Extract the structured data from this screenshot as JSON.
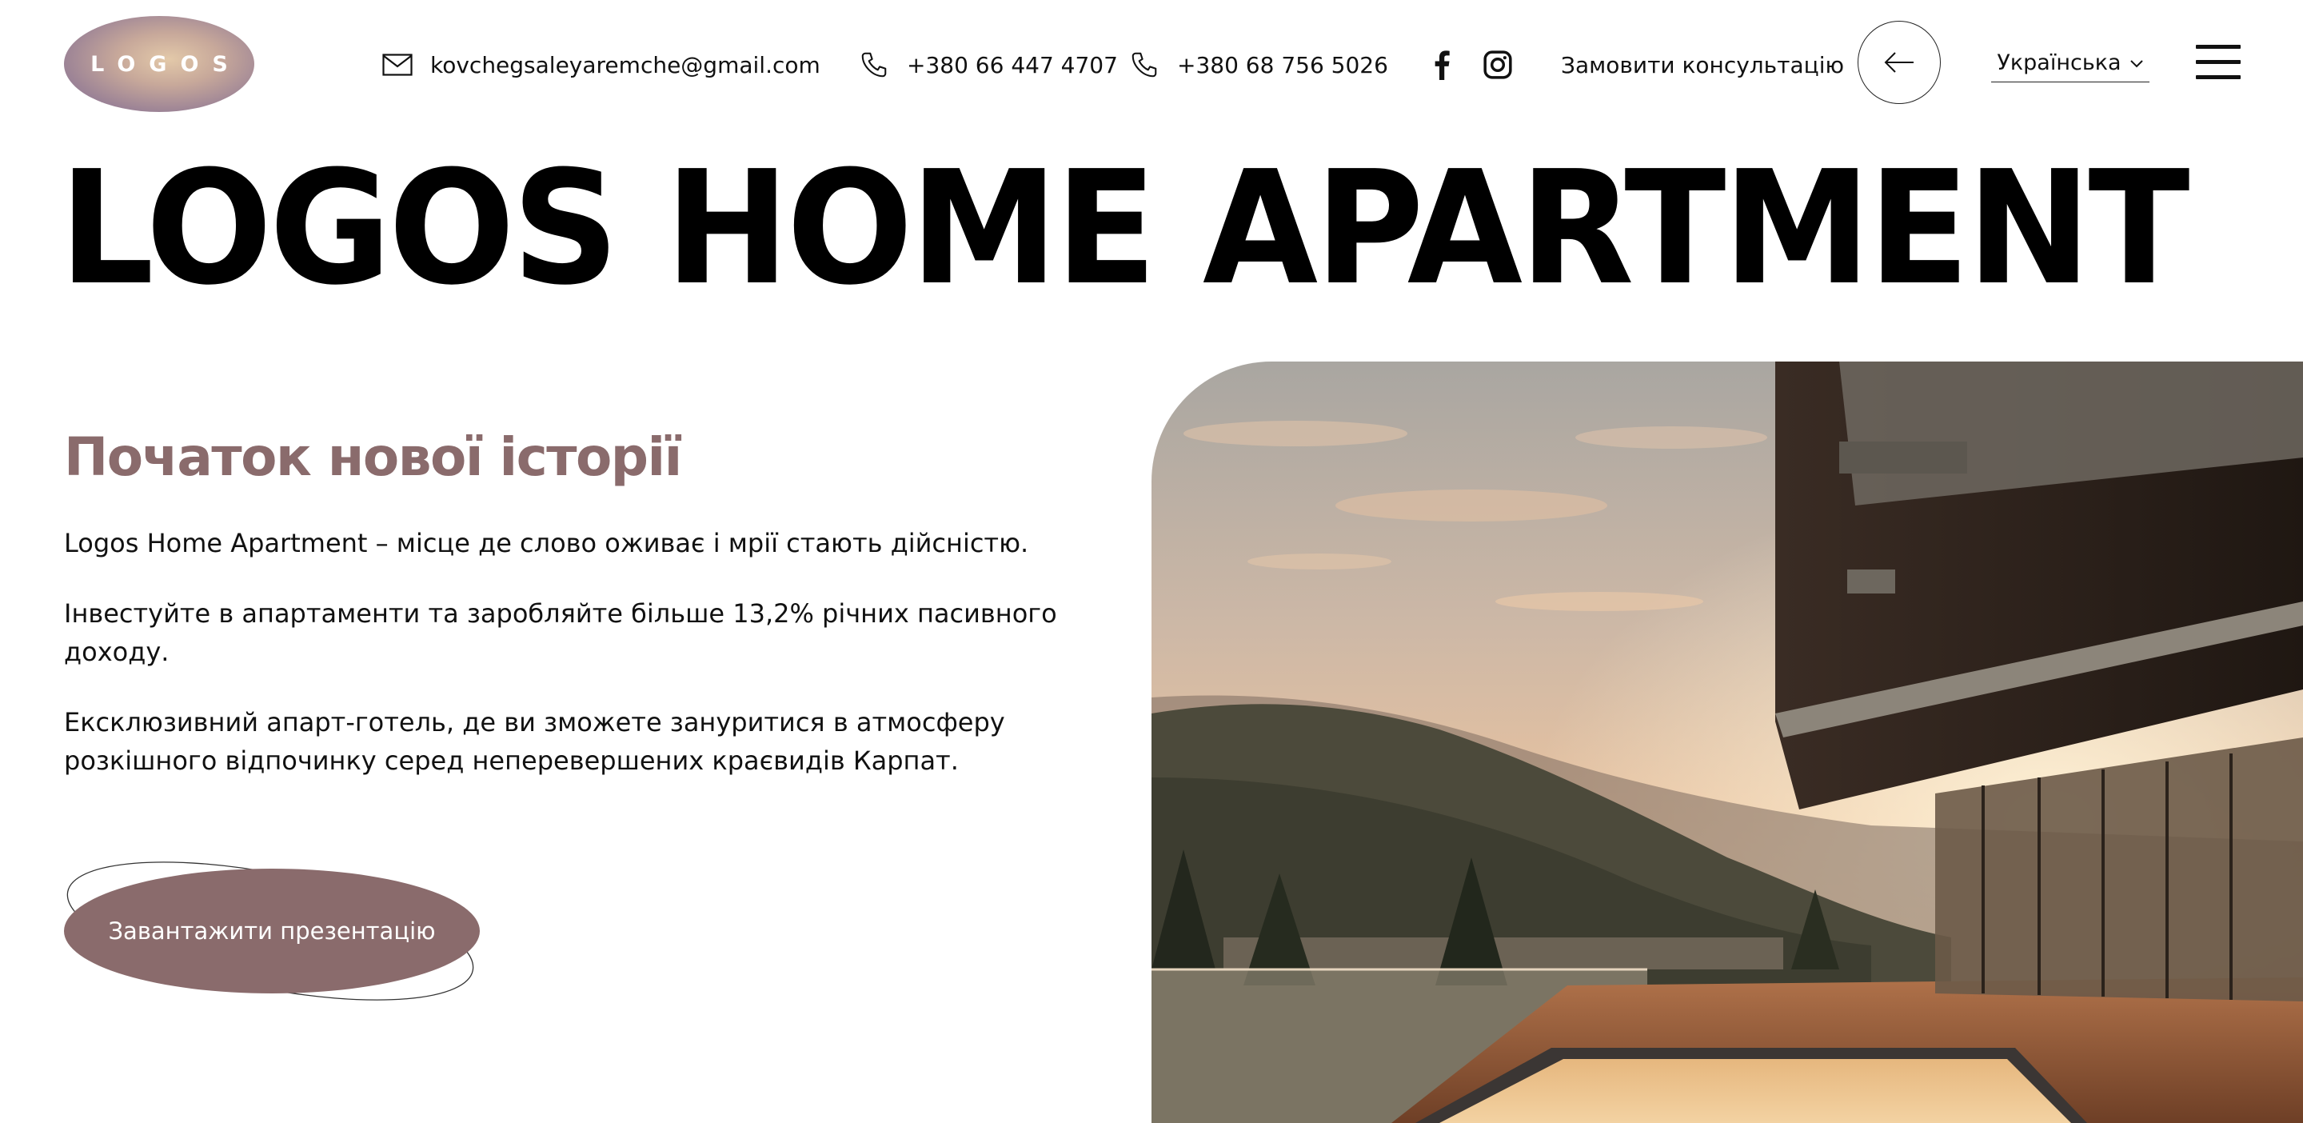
{
  "header": {
    "logo_text": "LOGOS",
    "email": "kovchegsaleyaremche@gmail.com",
    "phone_1": "+380 66 447 4707",
    "phone_2": "+380 68 756 5026",
    "social": [
      "facebook-icon",
      "instagram-icon"
    ],
    "cta_label": "Замовити консультацію",
    "cta_icon": "arrow-left-icon",
    "language": "Українська",
    "menu_icon": "hamburger-menu-icon"
  },
  "hero": {
    "title": "LOGOS HOME APARTMENT",
    "subtitle": "Початок нової історії",
    "paragraphs": [
      "Logos Home Apartment – місце де слово оживає і мрії стають дійсністю.",
      "Інвестуйте в апартаменти та заробляйте більше 13,2% річних пасивного доходу.",
      "Ексклюзивний апарт-готель, де ви зможете зануритися в атмосферу розкішного відпочинку серед неперевершених краєвидів Карпат."
    ],
    "download_button": "Завантажити презентацію"
  },
  "colors": {
    "accent": "#8a6b6c",
    "text": "#111111",
    "background": "#ffffff"
  }
}
